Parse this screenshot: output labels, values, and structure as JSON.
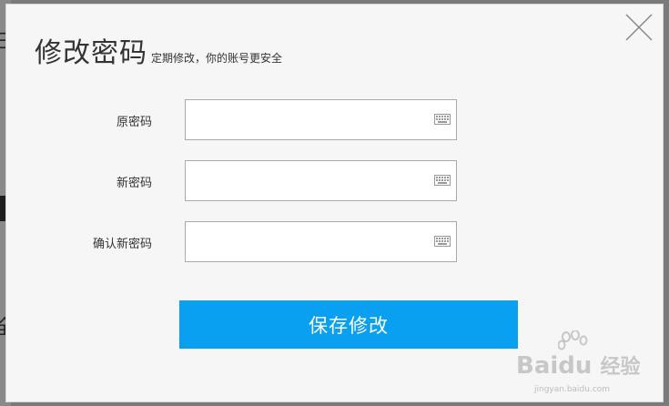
{
  "dialog": {
    "title": "修改密码",
    "subtitle": "定期修改，你的账号更安全",
    "fields": [
      {
        "label": "原密码",
        "value": ""
      },
      {
        "label": "新密码",
        "value": ""
      },
      {
        "label": "确认新密码",
        "value": ""
      }
    ],
    "save_label": "保存修改",
    "close_icon": "close-icon",
    "keyboard_icon": "keyboard-icon"
  },
  "background": {
    "glyph_top": "彐",
    "glyph_bottom": "全"
  },
  "watermark": {
    "brand_left": "Bai",
    "brand_right": "du",
    "brand_cn": "经验",
    "url": "jingyan.baidu.com"
  },
  "colors": {
    "accent": "#0aa0f2",
    "dialog_bg": "#f6f6f6",
    "overlay": "#7a7a7a"
  }
}
